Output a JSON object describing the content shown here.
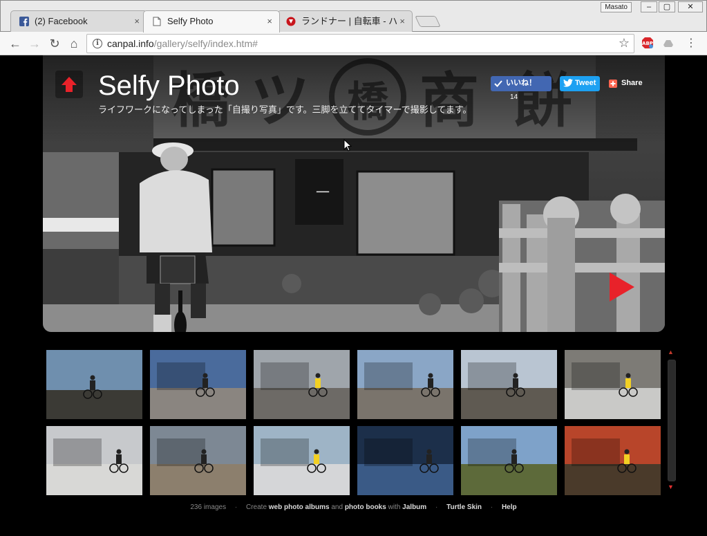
{
  "browser": {
    "user_label": "Masato",
    "window_buttons": [
      "–",
      "▢",
      "✕"
    ],
    "tabs": [
      {
        "title": "(2) Facebook",
        "close": "×",
        "favicon": "facebook-icon",
        "active": false
      },
      {
        "title": "Selfy Photo",
        "close": "×",
        "favicon": "page-icon",
        "active": true
      },
      {
        "title": "ランドナー | 自転車 - ハ",
        "close": "×",
        "favicon": "site-icon",
        "active": false
      }
    ],
    "nav": {
      "back": "←",
      "forward": "→",
      "reload": "↻",
      "home": "⌂"
    },
    "url_host": "canpal.info",
    "url_path": "/gallery/selfy/index.htm#",
    "bookmark_star": "☆",
    "menu": "⋮"
  },
  "gallery": {
    "title": "Selfy Photo",
    "description": "ライフワークになってしまった「自撮り写真」です。三脚を立ててタイマーで撮影してます。",
    "social": {
      "like_label": "いいね！",
      "like_count": "14",
      "tweet_label": "Tweet",
      "share_label": "Share"
    },
    "colors": {
      "accent_red": "#e8222a",
      "fb_blue": "#4267b2",
      "twitter_blue": "#1da1f2"
    }
  },
  "thumbnails": [
    {
      "scene": "sky-plain",
      "sky": "#6f8fae",
      "ground": "#3b3a35"
    },
    {
      "scene": "bridge",
      "sky": "#4a6b9c",
      "ground": "#8a8580"
    },
    {
      "scene": "shop",
      "sky": "#9fa5ab",
      "ground": "#6d6a66"
    },
    {
      "scene": "house",
      "sky": "#8aa6c6",
      "ground": "#7a746c"
    },
    {
      "scene": "village",
      "sky": "#b9c5d2",
      "ground": "#5f5a52"
    },
    {
      "scene": "rock-snow",
      "sky": "#7d7b76",
      "ground": "#c9c9c7"
    },
    {
      "scene": "temple",
      "sky": "#c7c9cc",
      "ground": "#d8d8d6"
    },
    {
      "scene": "field",
      "sky": "#7d8894",
      "ground": "#8c7f6d"
    },
    {
      "scene": "statue",
      "sky": "#9eb4c6",
      "ground": "#d5d6d8"
    },
    {
      "scene": "snow-shadow",
      "sky": "#1c2f4a",
      "ground": "#3a5a86"
    },
    {
      "scene": "mountain",
      "sky": "#7ea2c9",
      "ground": "#5d6a3a"
    },
    {
      "scene": "autumn",
      "sky": "#b8452a",
      "ground": "#4a3a2a"
    }
  ],
  "footer": {
    "count": "236 images",
    "create_prefix": "Create",
    "link_albums": "web photo albums",
    "and_text": "and",
    "link_books": "photo books",
    "with_text": "with",
    "link_jalbum": "Jalbum",
    "link_skin": "Turtle Skin",
    "link_help": "Help",
    "separator": "·"
  }
}
